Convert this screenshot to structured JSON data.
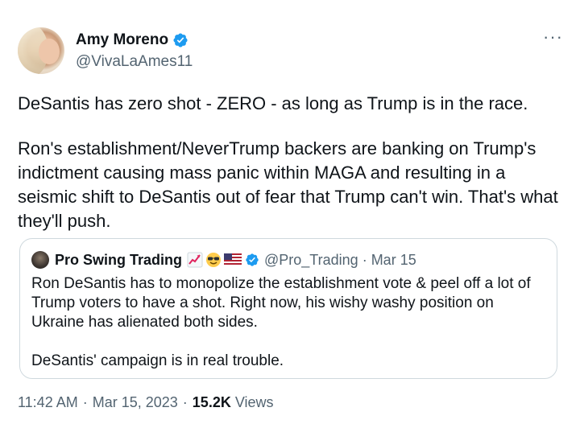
{
  "author": {
    "display_name": "Amy Moreno",
    "handle": "@VivaLaAmes11",
    "verified_icon": "verified-badge-icon",
    "avatar_icon": "user-avatar"
  },
  "more_menu": {
    "icon": "more-options-icon",
    "glyph": "···"
  },
  "tweet": {
    "paragraphs": [
      "DeSantis has zero shot - ZERO - as long as Trump is in the race.",
      "Ron's establishment/NeverTrump backers are banking on Trump's indictment causing mass panic within MAGA and resulting in a seismic shift to DeSantis out of fear that Trump can't win. That's what they'll push."
    ]
  },
  "quoted_tweet": {
    "display_name": "Pro Swing Trading",
    "emojis": [
      "chart-increasing-icon",
      "smiling-face-sunglasses-icon",
      "us-flag-icon"
    ],
    "handle": "@Pro_Trading",
    "separator": "·",
    "date": "Mar 15",
    "paragraphs": [
      "Ron DeSantis has to monopolize the establishment vote & peel off a lot of Trump voters to have a shot. Right now, his wishy washy position on Ukraine has alienated both sides.",
      "DeSantis' campaign is in real trouble."
    ]
  },
  "meta": {
    "time": "11:42 AM",
    "separator": "·",
    "date": "Mar 15, 2023",
    "views_count": "15.2K",
    "views_label": "Views"
  },
  "colors": {
    "verified_blue": "#1d9bf0",
    "secondary_text": "#536471",
    "primary_text": "#0f1419",
    "border": "#cfd9de"
  }
}
